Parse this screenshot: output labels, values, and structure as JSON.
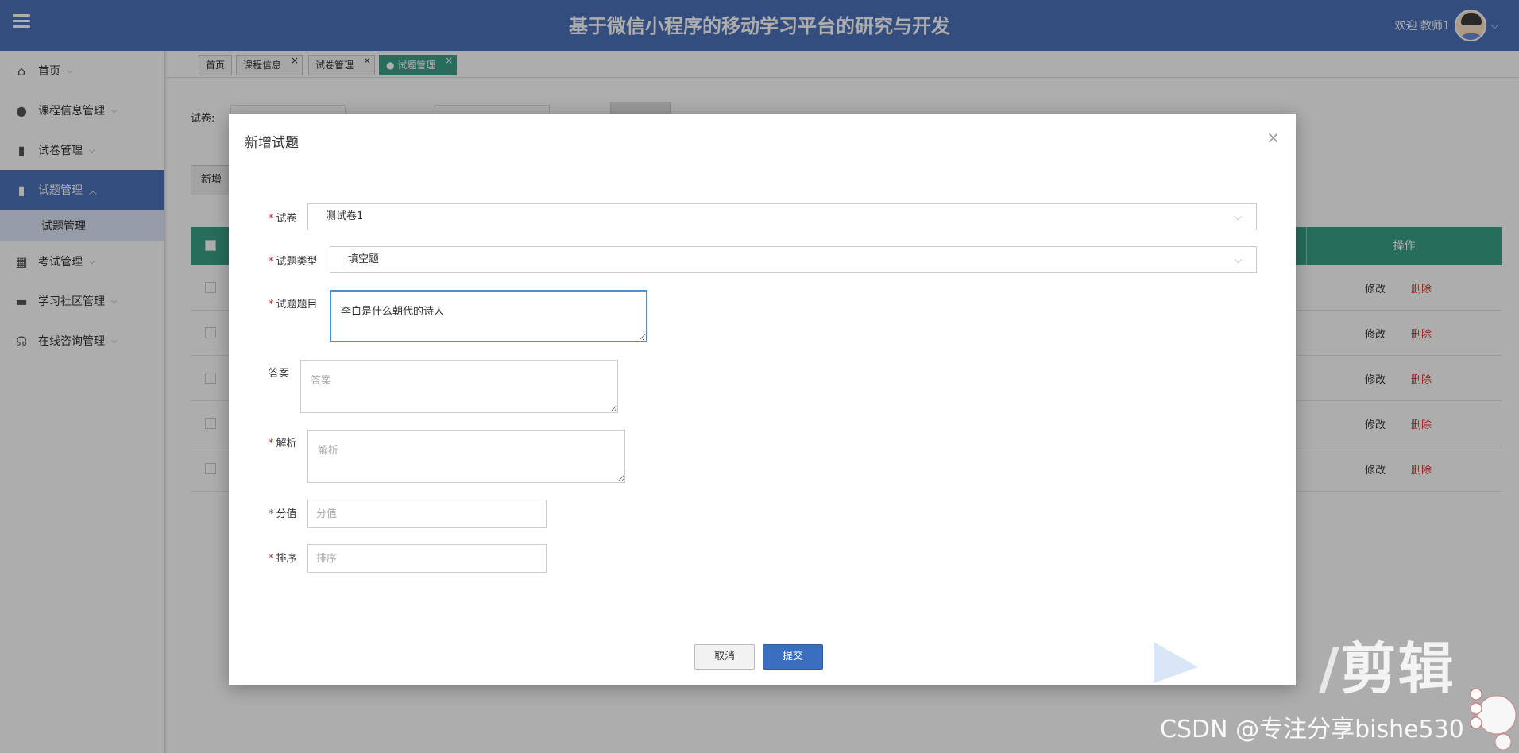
{
  "header": {
    "title": "基于微信小程序的移动学习平台的研究与开发",
    "welcome": "欢迎 教师1",
    "colors": {
      "header_bg": "#4a72ba",
      "active_tab": "#3aa188",
      "table_header": "#3aa188",
      "submit_btn": "#3a6fc0"
    }
  },
  "sidebar": {
    "items": [
      {
        "label": "首页",
        "icon": "home-icon"
      },
      {
        "label": "课程信息管理",
        "icon": "disc-icon"
      },
      {
        "label": "试卷管理",
        "icon": "book-icon"
      },
      {
        "label": "试题管理",
        "icon": "book-icon",
        "active": true
      },
      {
        "label": "考试管理",
        "icon": "grid-icon"
      },
      {
        "label": "学习社区管理",
        "icon": "tray-icon"
      },
      {
        "label": "在线咨询管理",
        "icon": "headset-icon"
      }
    ],
    "sub_item": "试题管理"
  },
  "tabs": [
    {
      "label": "首页"
    },
    {
      "label": "课程信息"
    },
    {
      "label": "试卷管理"
    },
    {
      "label": "试题管理",
      "active": true
    }
  ],
  "background_page": {
    "filter_label": "试卷:",
    "add_button": "新增",
    "op_header": "操作",
    "row_edit": "修改",
    "row_delete": "删除"
  },
  "modal": {
    "title": "新增试题",
    "fields": {
      "paper": {
        "label": "试卷",
        "value": "测试卷1"
      },
      "type": {
        "label": "试题类型",
        "value": "填空题"
      },
      "question": {
        "label": "试题题目",
        "value": "李白是什么朝代的诗人"
      },
      "answer": {
        "label": "答案",
        "placeholder": "答案"
      },
      "analysis": {
        "label": "解析",
        "placeholder": "解析"
      },
      "score": {
        "label": "分值",
        "placeholder": "分值"
      },
      "order": {
        "label": "排序",
        "placeholder": "排序"
      }
    },
    "cancel": "取消",
    "submit": "提交"
  },
  "watermark": {
    "editor": "剪辑",
    "csdn": "CSDN @专注分享bishe530"
  }
}
